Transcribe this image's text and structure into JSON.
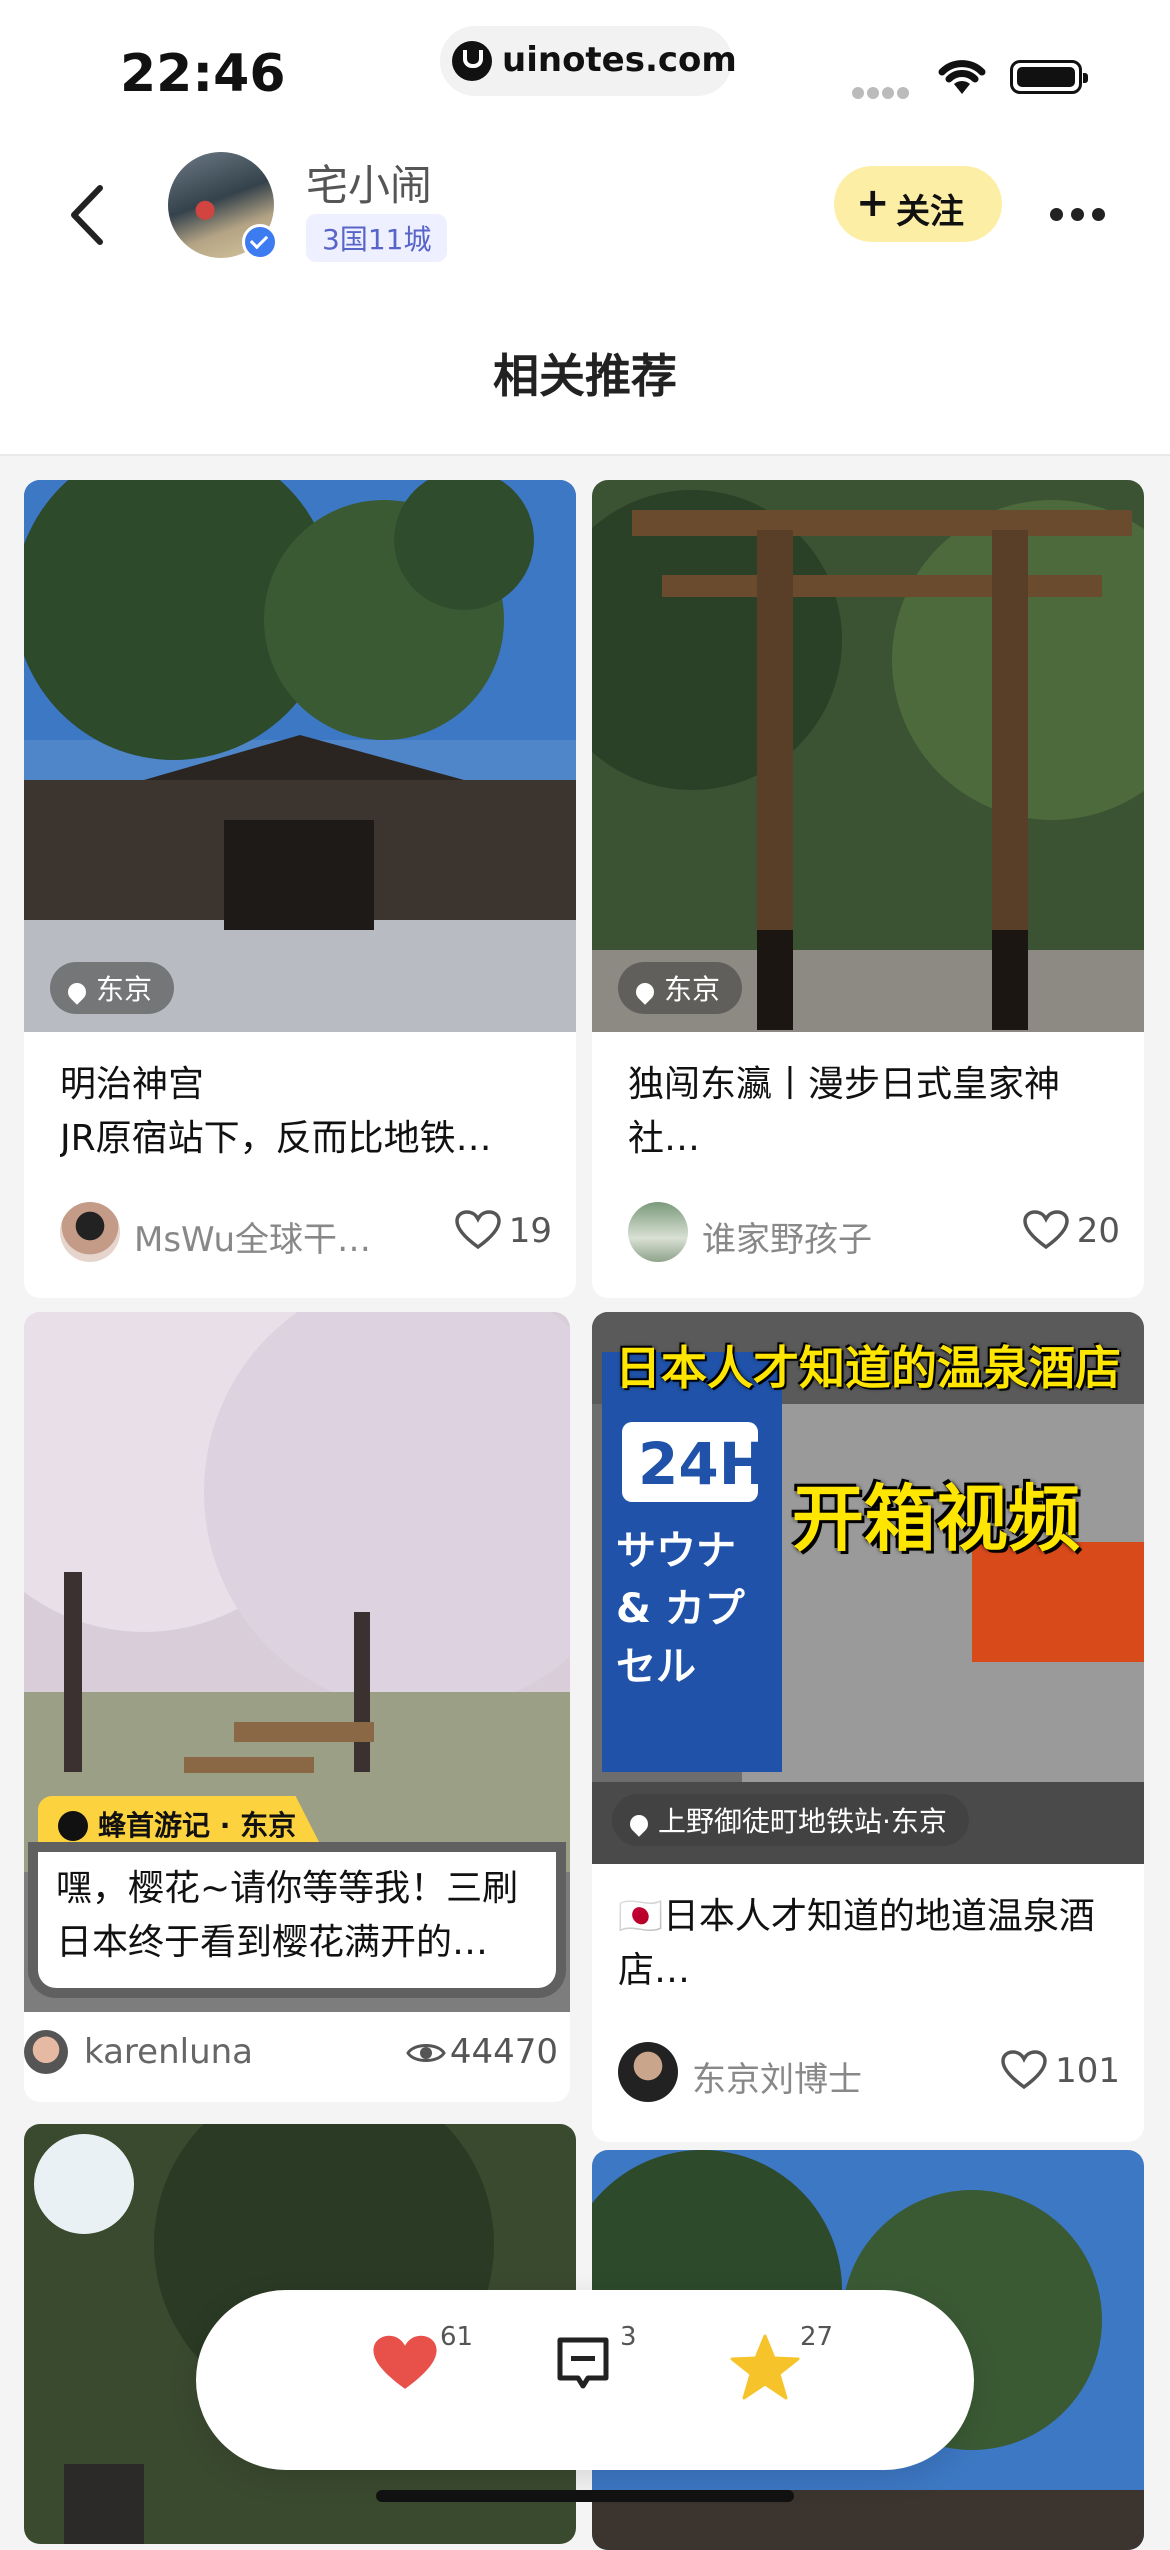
{
  "status": {
    "time": "22:46"
  },
  "browser": {
    "url": "uinotes.com"
  },
  "header": {
    "username": "宅小闹",
    "tag": "3国11城",
    "follow_label": "关注",
    "follow_plus": "+"
  },
  "section": {
    "title": "相关推荐"
  },
  "cards": [
    {
      "location": "东京",
      "title": "明治神宫\nJR原宿站下，反而比地铁…",
      "author": "MsWu全球干…",
      "likes": "19"
    },
    {
      "location": "东京",
      "title": "独闯东瀛丨漫步日式皇家神社…",
      "author": "谁家野孩子",
      "likes": "20"
    },
    {
      "badge": "蜂首游记 · 东京",
      "title": "嘿，樱花~请你等等我！三刷日本终于看到樱花满开的…",
      "author": "karenluna",
      "views": "44470"
    },
    {
      "location": "上野御徒町地铁站·东京",
      "image_text_top": "日本人才知道的温泉酒店",
      "image_text_sign": "24H",
      "image_text_sign2": "サウナ & カプセル",
      "image_text_big": "开箱视频",
      "title": "🇯🇵日本人才知道的地道温泉酒店…",
      "author": "东京刘博士",
      "likes": "101"
    }
  ],
  "dock": {
    "likes": "61",
    "comments": "3",
    "favorites": "27"
  },
  "colors": {
    "accent_follow": "#fdeea6",
    "heart": "#e8504a",
    "star": "#f6c32a",
    "badge": "#fcd33f"
  }
}
